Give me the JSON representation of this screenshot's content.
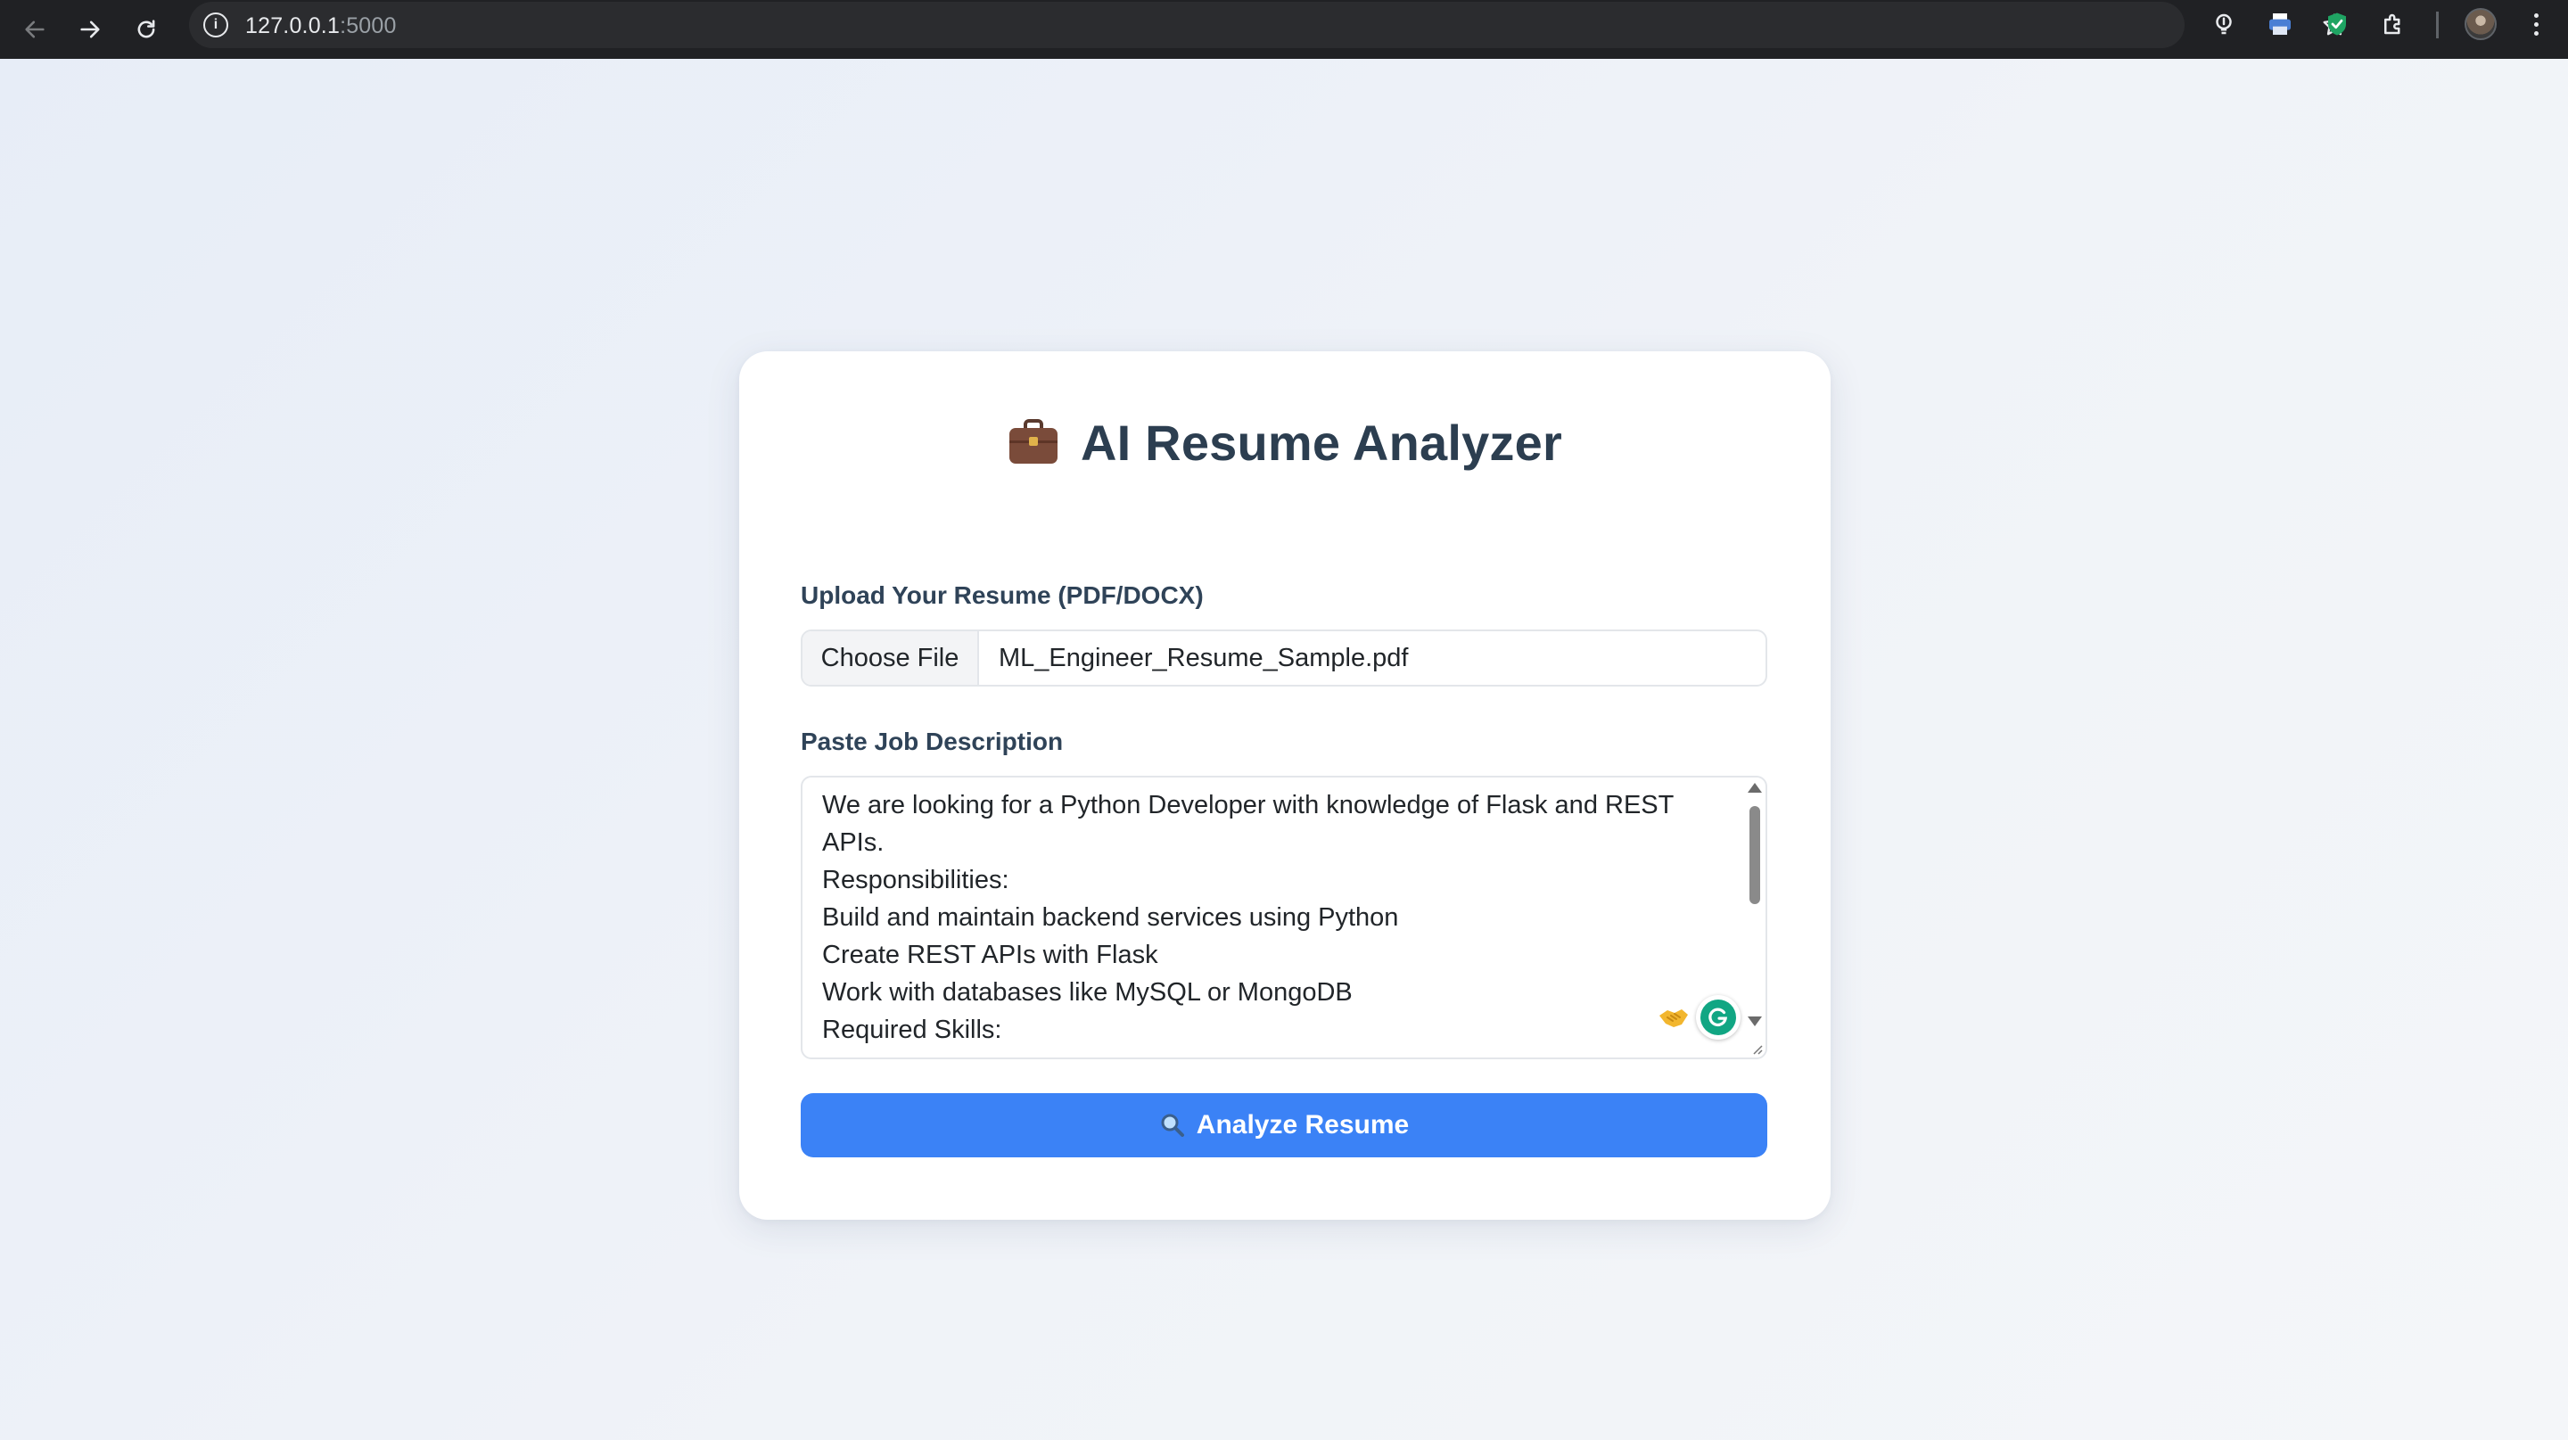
{
  "browser": {
    "url_host": "127.0.0.1",
    "url_port": ":5000"
  },
  "app": {
    "title": "AI Resume Analyzer",
    "title_icon": "briefcase-icon"
  },
  "upload": {
    "label": "Upload Your Resume (PDF/DOCX)",
    "choose_button": "Choose File",
    "file_name": "ML_Engineer_Resume_Sample.pdf"
  },
  "job_description": {
    "label": "Paste Job Description",
    "lines": [
      "We are looking for a Python Developer with knowledge of Flask and REST",
      "APIs.",
      "Responsibilities:",
      "Build and maintain backend services using Python",
      "Create REST APIs with Flask",
      "Work with databases like MySQL or MongoDB",
      "Required Skills:"
    ]
  },
  "analyze_button": {
    "label": "Analyze Resume",
    "icon": "magnifier-icon"
  },
  "colors": {
    "accent": "#3b82f6",
    "heading": "#2c3e50",
    "page_bg": "#e9eef6"
  }
}
